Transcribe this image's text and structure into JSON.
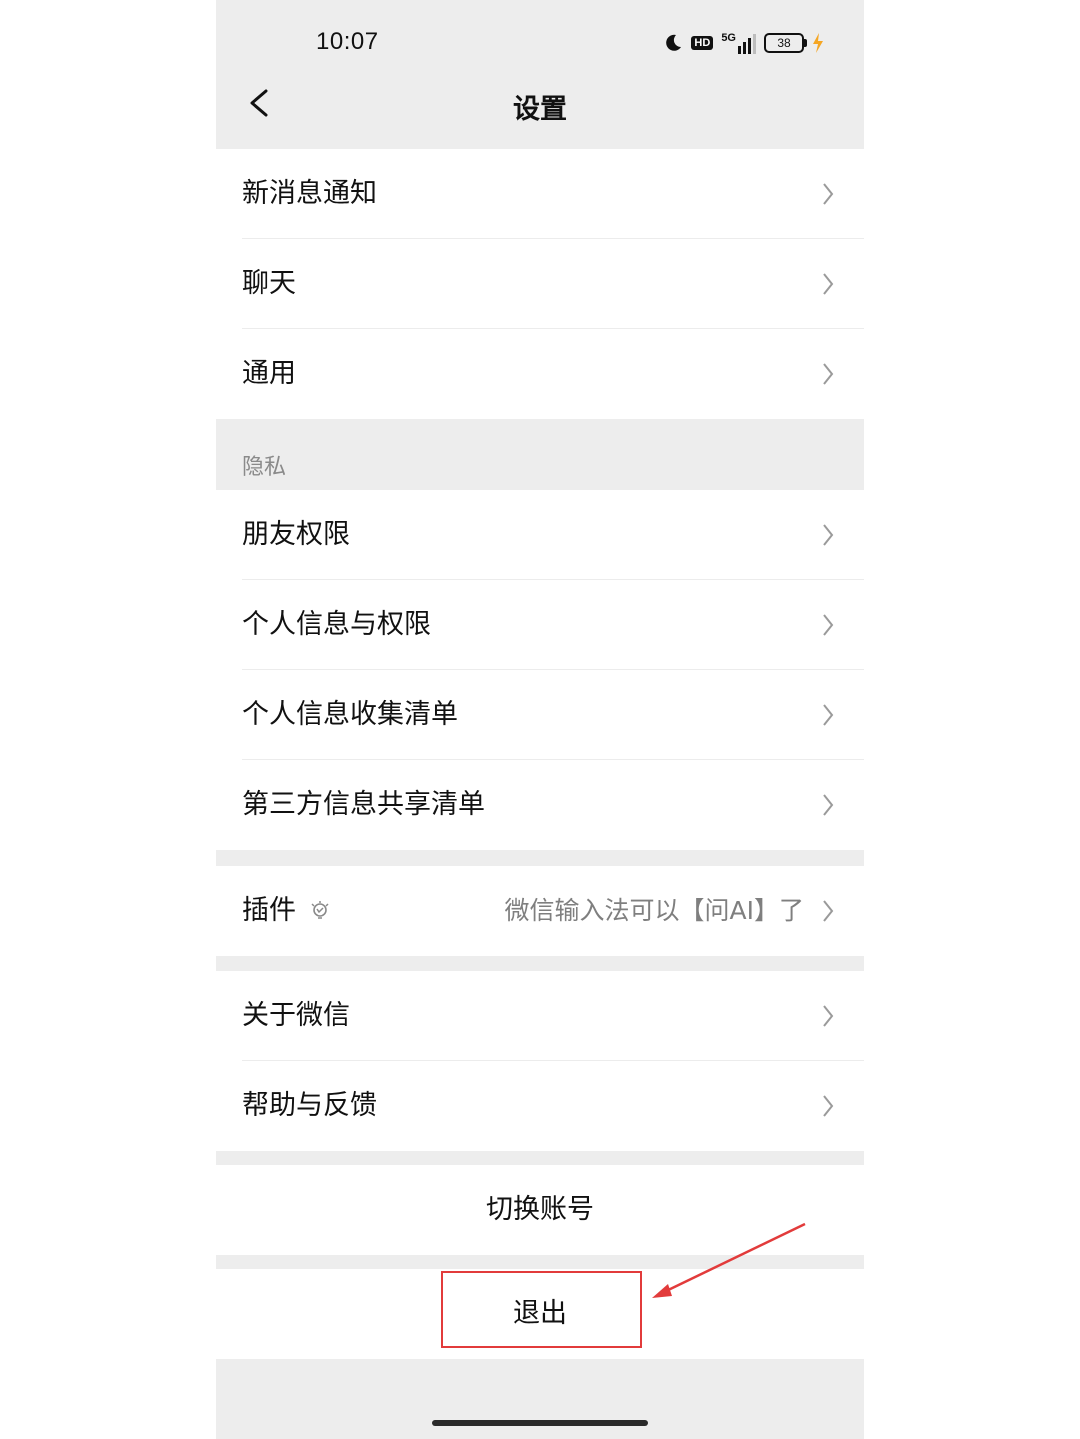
{
  "status_bar": {
    "time": "10:07",
    "network": "5G",
    "hd": "HD",
    "battery": "38"
  },
  "nav": {
    "title": "设置"
  },
  "groups": {
    "general": [
      {
        "label": "新消息通知"
      },
      {
        "label": "聊天"
      },
      {
        "label": "通用"
      }
    ],
    "privacy_header": "隐私",
    "privacy": [
      {
        "label": "朋友权限"
      },
      {
        "label": "个人信息与权限"
      },
      {
        "label": "个人信息收集清单"
      },
      {
        "label": "第三方信息共享清单"
      }
    ],
    "plugin": {
      "label": "插件",
      "value": "微信输入法可以【问AI】了"
    },
    "about": [
      {
        "label": "关于微信"
      },
      {
        "label": "帮助与反馈"
      }
    ]
  },
  "actions": {
    "switch_account": "切换账号",
    "logout": "退出"
  },
  "colors": {
    "page_bg": "#ededed",
    "annotation": "#e23b3b"
  },
  "icons": [
    "moon-icon",
    "hd-icon",
    "signal-5g-icon",
    "battery-icon",
    "charging-icon",
    "back-icon",
    "chevron-right-icon",
    "plugin-bulb-icon"
  ]
}
